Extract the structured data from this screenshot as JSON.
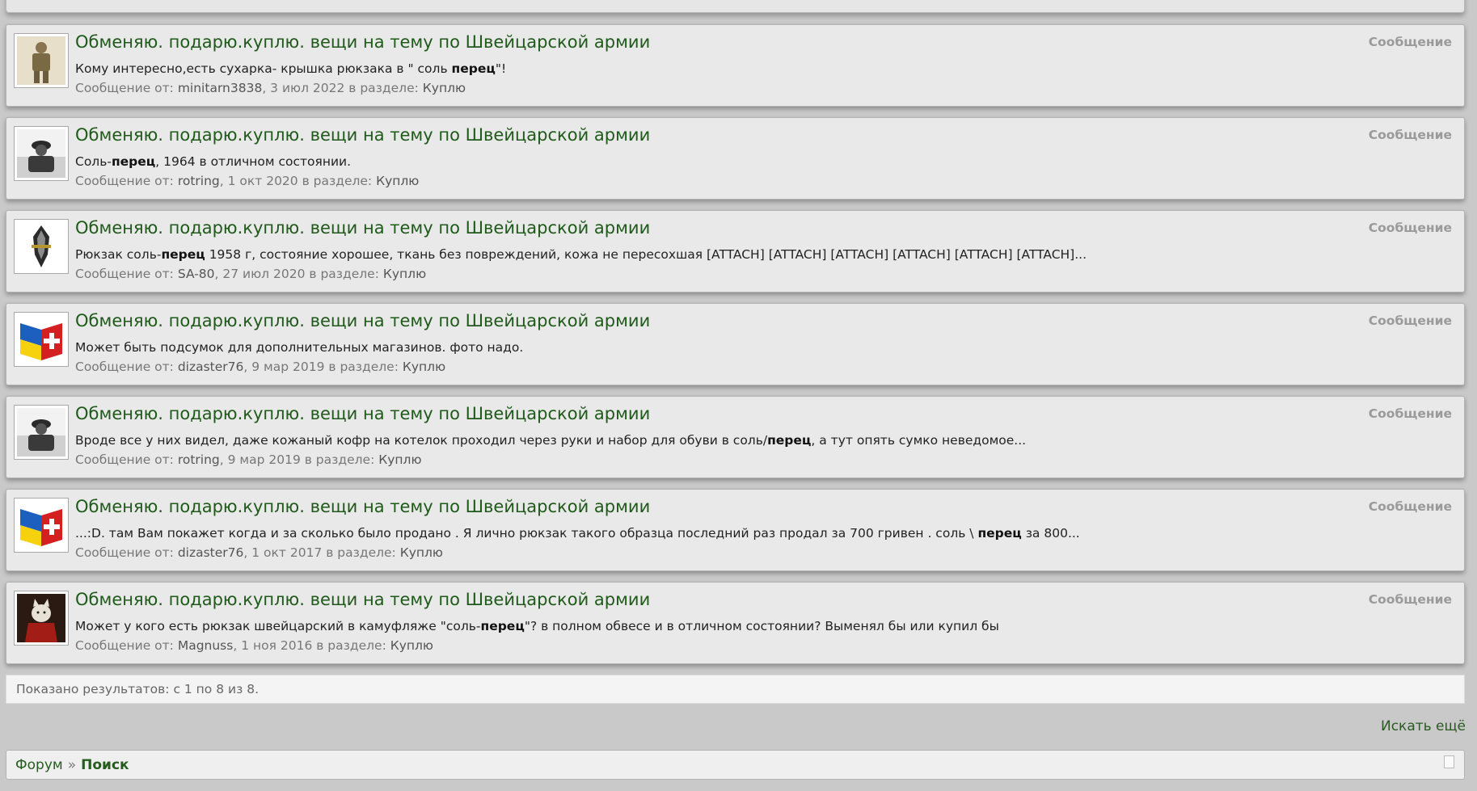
{
  "results": [
    {
      "avatar_icon": "soldier-photo",
      "title": "Обменяю. подарю.куплю. вещи на тему по Швейцарской армии",
      "snippet": [
        {
          "text": "Кому интересно,есть сухарка- крышка рюкзака в \" соль ",
          "bold": false
        },
        {
          "text": "перец",
          "bold": true
        },
        {
          "text": "\"!",
          "bold": false
        }
      ],
      "meta": {
        "prefix": "Сообщение от: ",
        "user": "minitarn3838",
        "date": ", 3 июл 2022 в разделе: ",
        "forum": "Куплю"
      },
      "type": "Сообщение"
    },
    {
      "avatar_icon": "soldier-bw-photo",
      "title": "Обменяю. подарю.куплю. вещи на тему по Швейцарской армии",
      "snippet": [
        {
          "text": "Соль-",
          "bold": false
        },
        {
          "text": "перец",
          "bold": true
        },
        {
          "text": ", 1964 в отличном состоянии.",
          "bold": false
        }
      ],
      "meta": {
        "prefix": "Сообщение от: ",
        "user": "rotring",
        "date": ", 1 окт 2020 в разделе: ",
        "forum": "Куплю"
      },
      "type": "Сообщение"
    },
    {
      "avatar_icon": "sas-dagger-emblem",
      "title": "Обменяю. подарю.куплю. вещи на тему по Швейцарской армии",
      "snippet": [
        {
          "text": "Рюкзак соль-",
          "bold": false
        },
        {
          "text": "перец",
          "bold": true
        },
        {
          "text": " 1958 г, состояние хорошее, ткань без повреждений, кожа не пересохшая [ATTACH] [ATTACH] [ATTACH] [ATTACH] [ATTACH] [ATTACH]...",
          "bold": false
        }
      ],
      "meta": {
        "prefix": "Сообщение от: ",
        "user": "SA-80",
        "date": ", 27 июл 2020 в разделе: ",
        "forum": "Куплю"
      },
      "type": "Сообщение"
    },
    {
      "avatar_icon": "ukraine-swiss-flags",
      "title": "Обменяю. подарю.куплю. вещи на тему по Швейцарской армии",
      "snippet": [
        {
          "text": "Может быть подсумок для дополнительных магазинов. фото надо.",
          "bold": false
        }
      ],
      "meta": {
        "prefix": "Сообщение от: ",
        "user": "dizaster76",
        "date": ", 9 мар 2019 в разделе: ",
        "forum": "Куплю"
      },
      "type": "Сообщение"
    },
    {
      "avatar_icon": "soldier-bw-photo",
      "title": "Обменяю. подарю.куплю. вещи на тему по Швейцарской армии",
      "snippet": [
        {
          "text": "Вроде все у них видел, даже кожаный кофр на котелок проходил через руки и набор для обуви в соль/",
          "bold": false
        },
        {
          "text": "перец",
          "bold": true
        },
        {
          "text": ", а тут опять сумко неведомое...",
          "bold": false
        }
      ],
      "meta": {
        "prefix": "Сообщение от: ",
        "user": "rotring",
        "date": ", 9 мар 2019 в разделе: ",
        "forum": "Куплю"
      },
      "type": "Сообщение"
    },
    {
      "avatar_icon": "ukraine-swiss-flags",
      "title": "Обменяю. подарю.куплю. вещи на тему по Швейцарской армии",
      "snippet": [
        {
          "text": "...:D. там Вам покажет когда и за сколько было продано . Я лично рюкзак такого образца последний раз продал за 700 гривен . соль \\ ",
          "bold": false
        },
        {
          "text": "перец",
          "bold": true
        },
        {
          "text": " за 800...",
          "bold": false
        }
      ],
      "meta": {
        "prefix": "Сообщение от: ",
        "user": "dizaster76",
        "date": ", 1 окт 2017 в разделе: ",
        "forum": "Куплю"
      },
      "type": "Сообщение"
    },
    {
      "avatar_icon": "cat-portrait",
      "title": "Обменяю. подарю.куплю. вещи на тему по Швейцарской армии",
      "snippet": [
        {
          "text": "Может у кого есть рюкзак швейцарский в камуфляже \"соль-",
          "bold": false
        },
        {
          "text": "перец",
          "bold": true
        },
        {
          "text": "\"? в полном обвесе и в отличном состоянии? Выменял бы или купил бы",
          "bold": false
        }
      ],
      "meta": {
        "prefix": "Сообщение от: ",
        "user": "Magnuss",
        "date": ", 1 ноя 2016 в разделе: ",
        "forum": "Куплю"
      },
      "type": "Сообщение"
    }
  ],
  "pagination_summary": "Показано результатов: с 1 по 8 из 8.",
  "search_more_label": "Искать ещё",
  "breadcrumb": {
    "forum": "Форум",
    "separator": "»",
    "current": "Поиск"
  },
  "colors": {
    "title": "#1f5a1a",
    "link": "#245d1d",
    "type": "#9a9a9a",
    "background": "#c9c9c9"
  }
}
